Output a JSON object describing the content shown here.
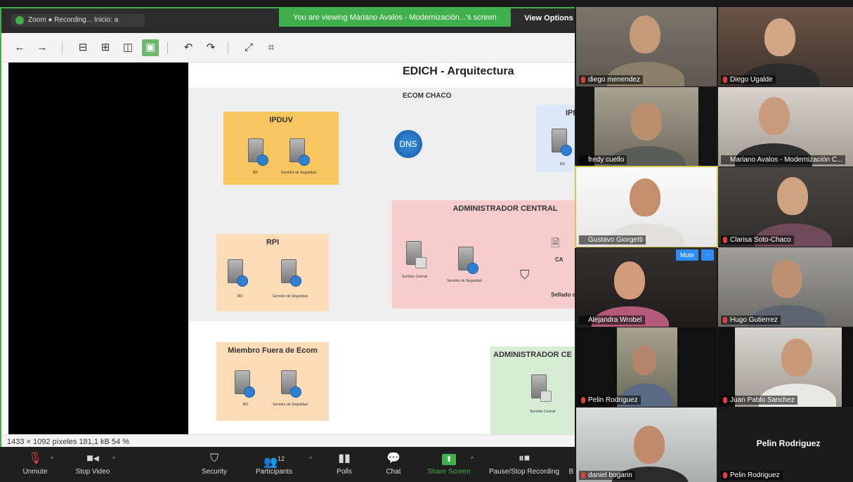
{
  "share": {
    "recording_text": "Zoom ● Recording... Inicio: a",
    "viewing_banner": "You are viewing Mariano Avalos - Modernización...'s screen",
    "view_options": "View Options"
  },
  "toolbar": {
    "icons": [
      "back-arrow-icon",
      "forward-arrow-icon",
      "fit-icon",
      "zoom-icon",
      "actual-size-icon",
      "view-mode-icon",
      "rotate-left-icon",
      "rotate-right-icon",
      "fullscreen-icon",
      "crop-icon"
    ]
  },
  "diagram": {
    "title": "EDICH - Arquitectura",
    "ecom_label": "ECOM CHACO",
    "dns_label": "DNS",
    "boxes": {
      "ipduv": {
        "title": "IPDUV",
        "labels": [
          "BD",
          "Servidor de Seguridad"
        ]
      },
      "ipi": {
        "title": "IPI",
        "labels": [
          "BD"
        ]
      },
      "rpi": {
        "title": "RPI",
        "labels": [
          "BD",
          "Servidor de Seguridad"
        ]
      },
      "admin_central": {
        "title": "ADMINISTRADOR CENTRAL",
        "labels": [
          "Servidor Central",
          "Servidor de Seguridad",
          "CA",
          "Sellado d"
        ]
      },
      "miembro": {
        "title": "Miembro Fuera de Ecom",
        "labels": [
          "BD",
          "Servidor de Seguridad"
        ]
      },
      "admin_ce": {
        "title": "ADMINISTRADOR CE",
        "labels": [
          "Servidor Central"
        ]
      }
    },
    "colors": {
      "yellow": "#f7c65f",
      "peach": "#fbdcb7",
      "pink": "#f6cccc",
      "blue": "#dce8f8",
      "green": "#d6ecd4"
    }
  },
  "status_bar": "1433 × 1092 píxeles  181,1 kB   54 %",
  "controls": {
    "unmute": "Unmute",
    "stop_video": "Stop Video",
    "security": "Security",
    "participants": "Participants",
    "participants_count": "12",
    "polls": "Polls",
    "chat": "Chat",
    "share_screen": "Share Screen",
    "pause_recording": "Pause/Stop Recording",
    "truncated": "B"
  },
  "participants": [
    {
      "name": "diego menendez"
    },
    {
      "name": "Diego Ugalde"
    },
    {
      "name": "fredy cuello"
    },
    {
      "name": "Mariano Avalos - Modernización C..."
    },
    {
      "name": "Gustavo Giorgetti"
    },
    {
      "name": "Clarisa Soto-Chaco"
    },
    {
      "name": "Alejandra Wrobel"
    },
    {
      "name": "Hugo Gutierrez"
    },
    {
      "name": "Pelin Rodriguez"
    },
    {
      "name": "Juan Pablo Sanchez"
    },
    {
      "name": "daniel bogarin"
    },
    {
      "name": "Pelin Rodriguez",
      "big_name": "Pelin Rodriguez"
    }
  ],
  "tile_buttons": {
    "mute": "Mute",
    "more": "···"
  },
  "accent": {
    "green": "#3fb04b",
    "blue": "#2d8cff",
    "red": "#e43f3f"
  }
}
